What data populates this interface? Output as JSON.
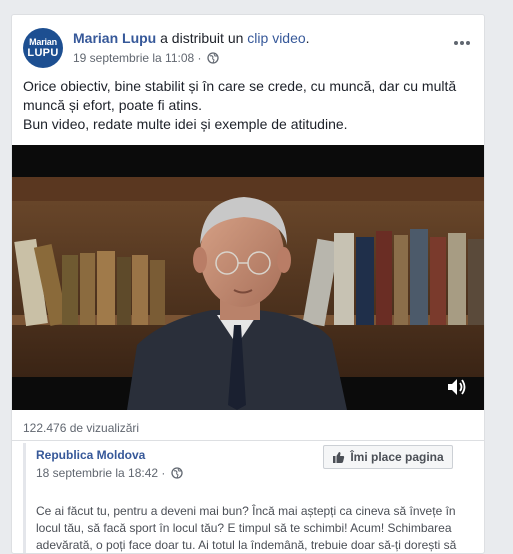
{
  "post": {
    "author": "Marian Lupu",
    "action_text": " a distribuit un ",
    "action_link": "clip video",
    "action_end": ".",
    "avatar_line1": "Marian",
    "avatar_line2": "LUPU",
    "timestamp": "19 septembrie la 11:08",
    "separator": " · ",
    "text_line1": "Orice obiectiv, bine stabilit și în care se crede, cu muncă, dar cu multă muncă și efort, poate fi atins.",
    "text_line2": "Bun video, redate multe idei și exemple de atitudine."
  },
  "video": {
    "sound_icon": "speaker-icon",
    "views": "122.476 de vizualizări"
  },
  "shared": {
    "page_name": "Republica Moldova",
    "timestamp": "18 septembrie la 18:42",
    "separator": " · ",
    "like_button": "Îmi place pagina",
    "text": "Ce ai făcut tu, pentru a deveni mai bun? Încă mai aștepți ca cineva să învețe în locul tău, să facă sport în locul tău? E timpul să te schimbi! Acum! Schimbarea adevărată, o poți face doar tu. Ai totul la îndemână, trebuie doar să-ți dorești să"
  },
  "colors": {
    "link": "#365899",
    "meta": "#616770",
    "background": "#e9ebee"
  }
}
